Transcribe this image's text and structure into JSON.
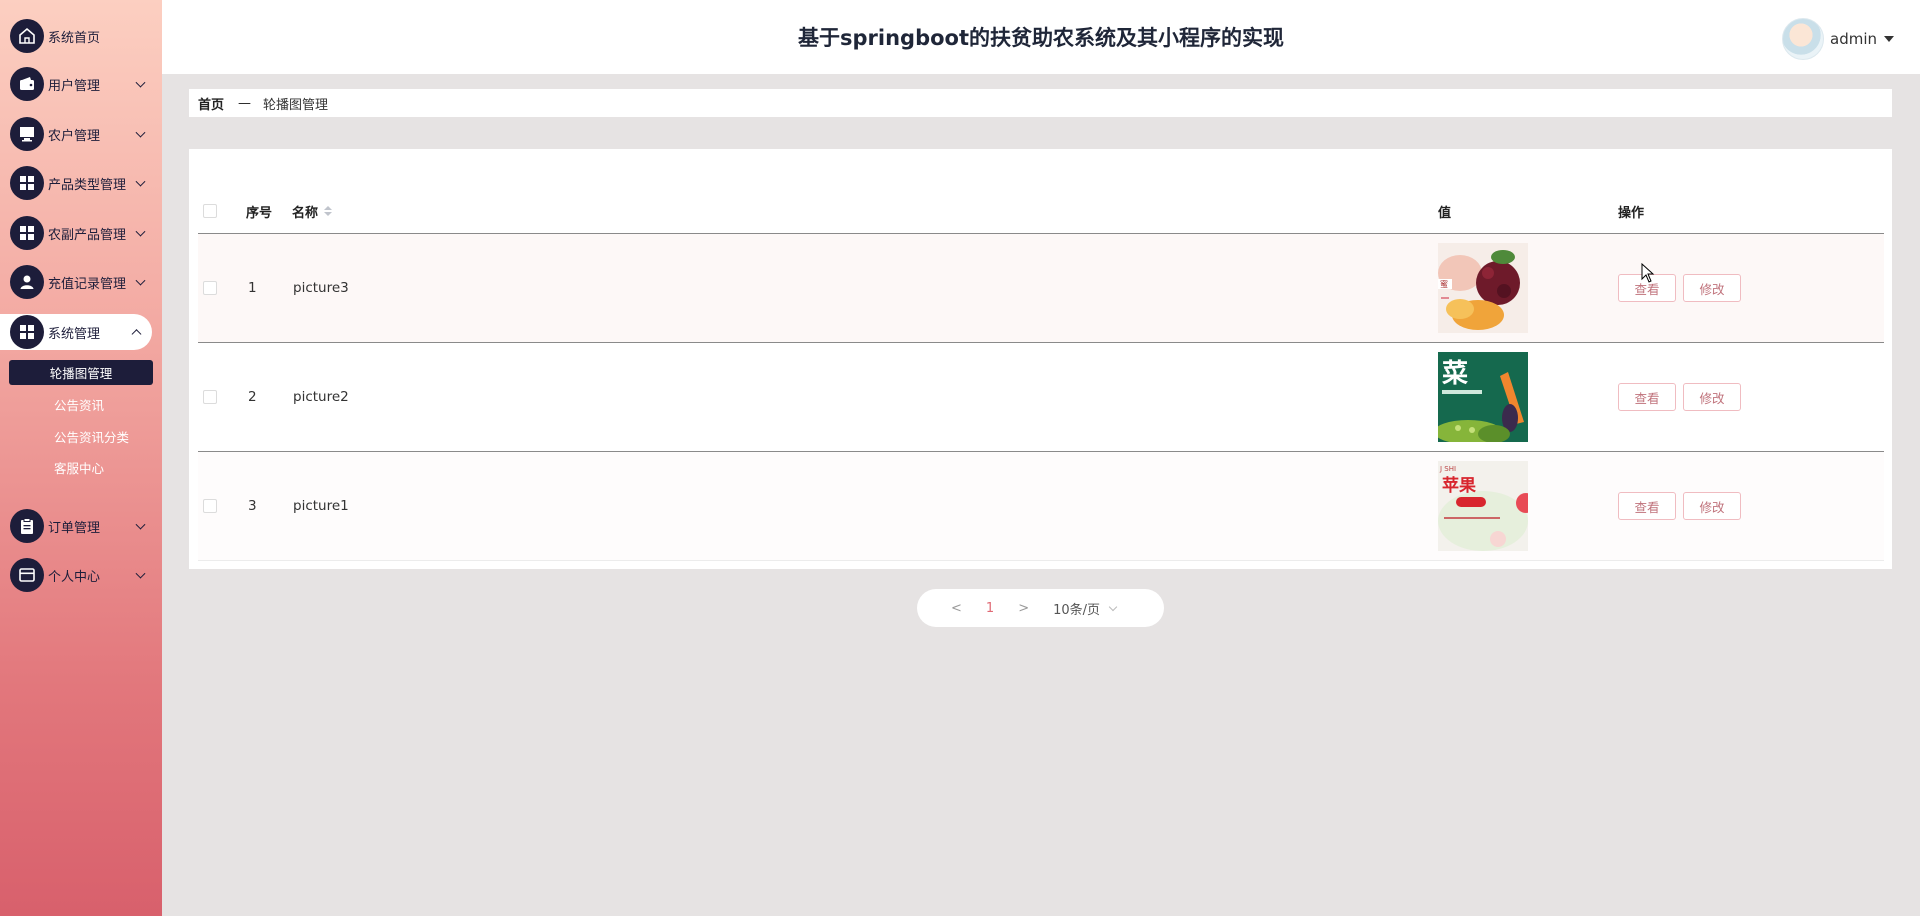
{
  "header": {
    "title": "基于springboot的扶贫助农系统及其小程序的实现",
    "user": {
      "name": "admin",
      "avatar_icon": "user-avatar"
    }
  },
  "sidebar": {
    "items": [
      {
        "label": "系统首页",
        "icon": "home-icon"
      },
      {
        "label": "用户管理",
        "icon": "wallet-icon"
      },
      {
        "label": "农户管理",
        "icon": "monitor-icon"
      },
      {
        "label": "产品类型管理",
        "icon": "grid-icon"
      },
      {
        "label": "农副产品管理",
        "icon": "grid-icon"
      },
      {
        "label": "充值记录管理",
        "icon": "person-icon"
      },
      {
        "label": "系统管理",
        "icon": "grid-icon",
        "expanded": true
      },
      {
        "label": "订单管理",
        "icon": "clipboard-icon"
      },
      {
        "label": "个人中心",
        "icon": "card-icon"
      }
    ],
    "subitems": [
      {
        "label": "轮播图管理",
        "active": true
      },
      {
        "label": "公告资讯"
      },
      {
        "label": "公告资讯分类"
      },
      {
        "label": "客服中心"
      }
    ]
  },
  "breadcrumb": {
    "home": "首页",
    "separator": "—",
    "current": "轮播图管理"
  },
  "table": {
    "columns": {
      "index": "序号",
      "name": "名称",
      "value": "值",
      "actions": "操作"
    },
    "rows": [
      {
        "index": "1",
        "name": "picture3",
        "image": "fruit-photo"
      },
      {
        "index": "2",
        "name": "picture2",
        "image": "vegetable-photo"
      },
      {
        "index": "3",
        "name": "picture1",
        "image": "apple-poster"
      }
    ],
    "view_label": "查看",
    "edit_label": "修改"
  },
  "pagination": {
    "prev": "<",
    "page": "1",
    "next": ">",
    "page_size": "10条/页"
  },
  "colors": {
    "sidebar_dark": "#1d1d3a",
    "accent": "#e06a75",
    "button_border": "#f0bcc1"
  }
}
